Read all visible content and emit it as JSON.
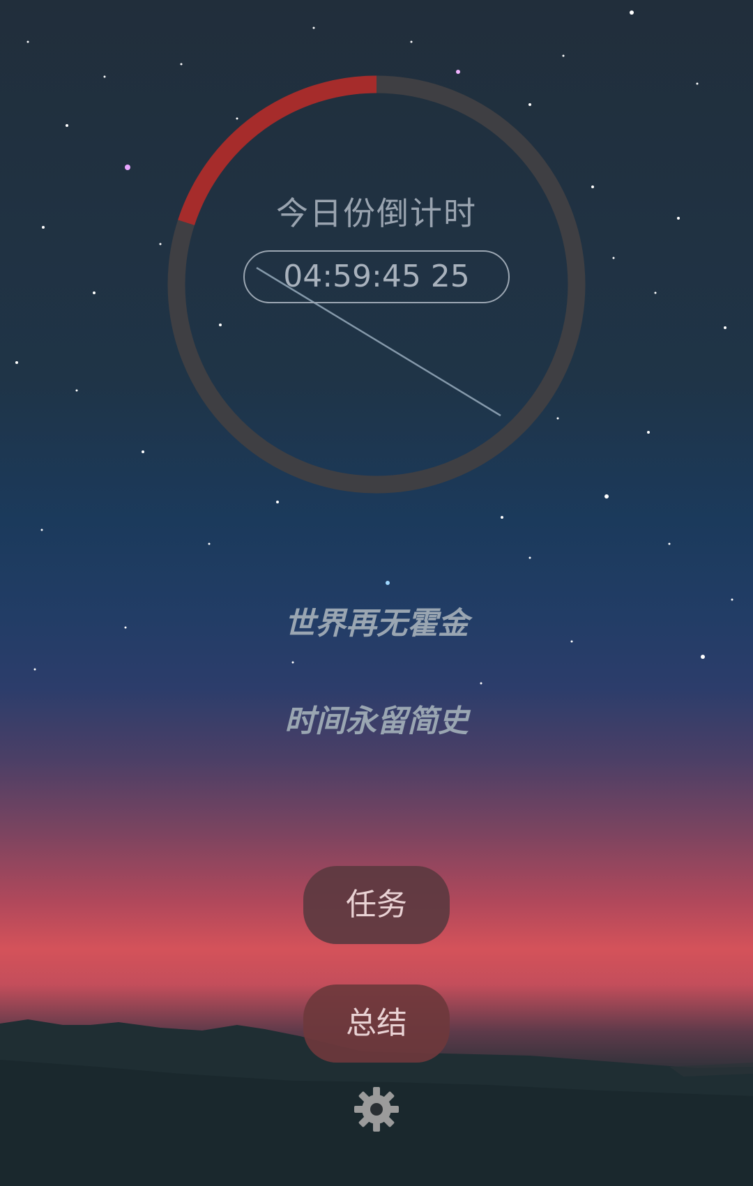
{
  "countdown": {
    "title": "今日份倒计时",
    "time": "04:59:45 25",
    "progress_fraction": 0.2,
    "progress_color": "#a62c2b",
    "track_color": "#3f3f43"
  },
  "quote": {
    "line1": "世界再无霍金",
    "line2": "时间永留简史"
  },
  "buttons": {
    "task_label": "任务",
    "summary_label": "总结"
  },
  "settings": {
    "icon": "gear-icon"
  }
}
